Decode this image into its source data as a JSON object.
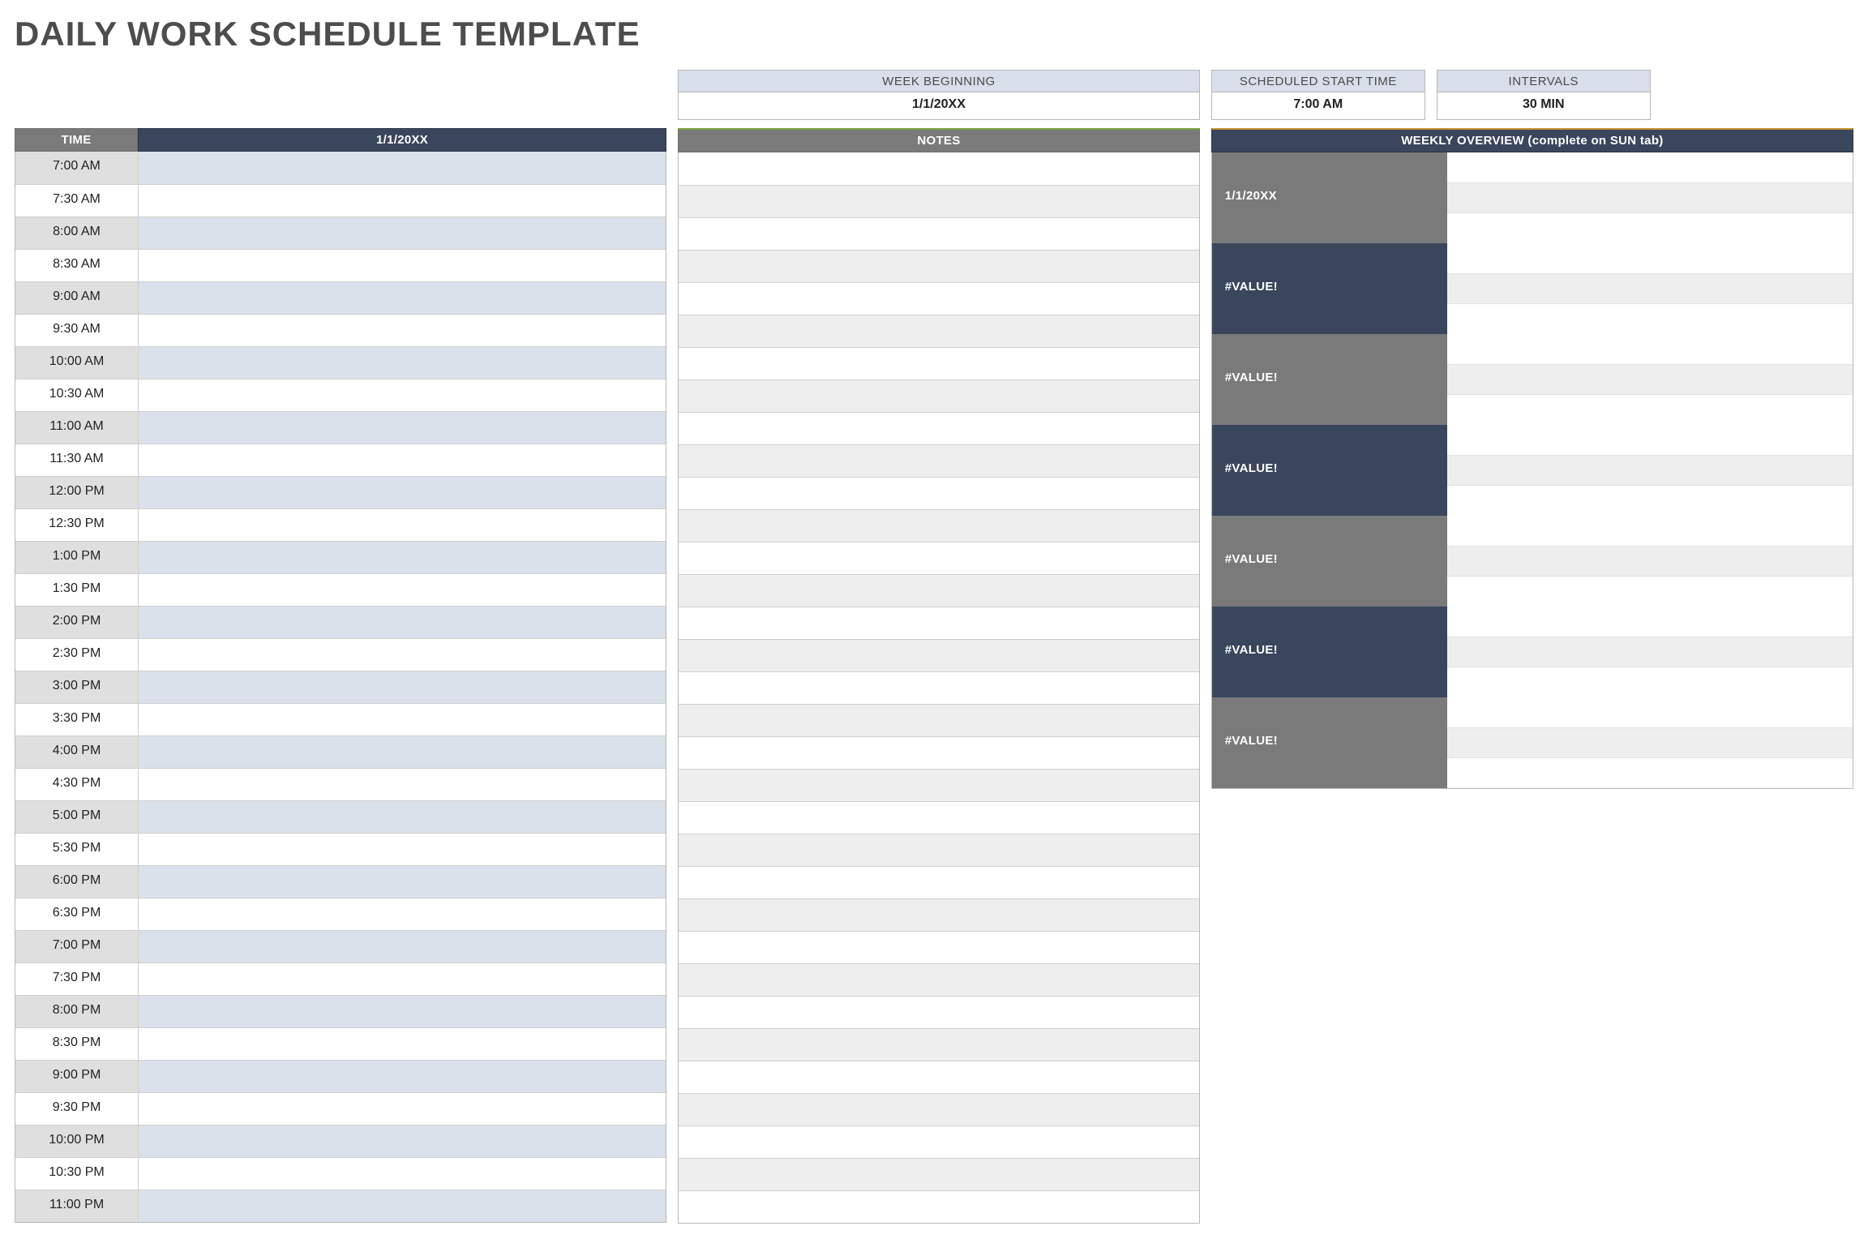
{
  "title": "DAILY WORK SCHEDULE TEMPLATE",
  "params": {
    "weekBeginning": {
      "label": "WEEK BEGINNING",
      "value": "1/1/20XX"
    },
    "startTime": {
      "label": "SCHEDULED START TIME",
      "value": "7:00 AM"
    },
    "intervals": {
      "label": "INTERVALS",
      "value": "30 MIN"
    }
  },
  "schedule": {
    "timeHeader": "TIME",
    "dateHeader": "1/1/20XX",
    "times": [
      "7:00 AM",
      "7:30 AM",
      "8:00 AM",
      "8:30 AM",
      "9:00 AM",
      "9:30 AM",
      "10:00 AM",
      "10:30 AM",
      "11:00 AM",
      "11:30 AM",
      "12:00 PM",
      "12:30 PM",
      "1:00 PM",
      "1:30 PM",
      "2:00 PM",
      "2:30 PM",
      "3:00 PM",
      "3:30 PM",
      "4:00 PM",
      "4:30 PM",
      "5:00 PM",
      "5:30 PM",
      "6:00 PM",
      "6:30 PM",
      "7:00 PM",
      "7:30 PM",
      "8:00 PM",
      "8:30 PM",
      "9:00 PM",
      "9:30 PM",
      "10:00 PM",
      "10:30 PM",
      "11:00 PM"
    ]
  },
  "notes": {
    "header": "NOTES"
  },
  "overview": {
    "header": "WEEKLY OVERVIEW (complete on SUN tab)",
    "days": [
      {
        "label": "1/1/20XX",
        "tone": "gray"
      },
      {
        "label": "#VALUE!",
        "tone": "navy"
      },
      {
        "label": "#VALUE!",
        "tone": "gray"
      },
      {
        "label": "#VALUE!",
        "tone": "navy"
      },
      {
        "label": "#VALUE!",
        "tone": "gray"
      },
      {
        "label": "#VALUE!",
        "tone": "navy"
      },
      {
        "label": "#VALUE!",
        "tone": "gray"
      }
    ]
  }
}
